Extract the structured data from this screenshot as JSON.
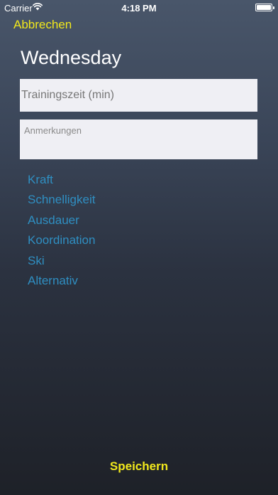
{
  "status_bar": {
    "carrier": "Carrier",
    "time": "4:18 PM",
    "wifi_icon": "wifi-icon",
    "battery_icon": "battery-icon",
    "battery_level": 1.0
  },
  "nav": {
    "cancel_label": "Abbrechen"
  },
  "day": {
    "title": "Wednesday"
  },
  "form": {
    "training_time_placeholder": "Trainingszeit (min)",
    "training_time_value": "",
    "notes_placeholder": "Anmerkungen",
    "notes_value": ""
  },
  "categories": [
    {
      "label": "Kraft"
    },
    {
      "label": "Schnelligkeit"
    },
    {
      "label": "Ausdauer"
    },
    {
      "label": "Koordination"
    },
    {
      "label": "Ski"
    },
    {
      "label": "Alternativ"
    }
  ],
  "footer": {
    "save_label": "Speichern"
  },
  "colors": {
    "accent_yellow": "#f1e81c",
    "category_blue": "#2f8fc2",
    "input_background": "#efeff4",
    "background_top": "#49566a",
    "background_bottom": "#1e2128"
  }
}
